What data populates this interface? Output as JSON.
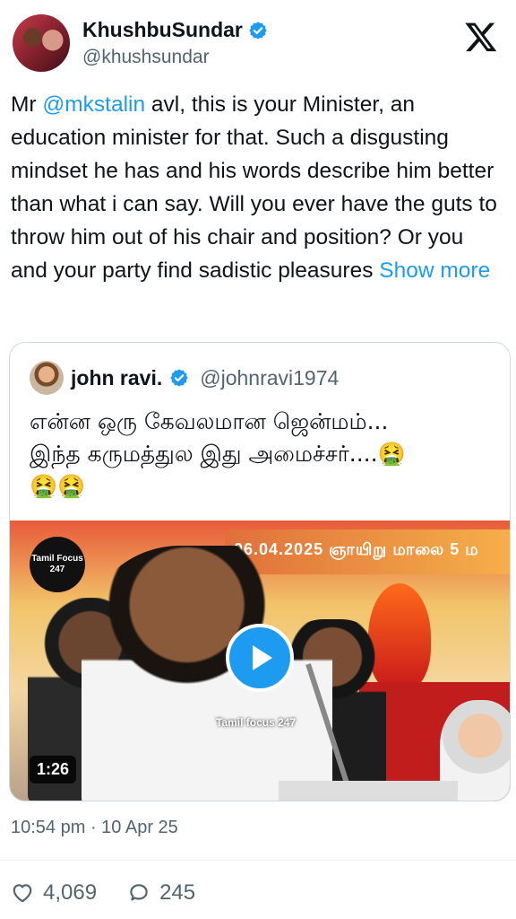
{
  "author": {
    "display_name": "KhushbuSundar",
    "handle": "@khushsundar",
    "verified_color": "#1d9bf0"
  },
  "tweet": {
    "text_before_mention": "Mr ",
    "mention": "@mkstalin",
    "text_after_mention": " avl, this is your Minister, an education minister for that. Such a disgusting mindset he has and his words describe him better than what i can say. Will you ever have the guts to throw him out of his chair and position? Or you and your party find sadistic pleasures ",
    "show_more": "Show more"
  },
  "quoted": {
    "display_name": "john ravi.",
    "handle": "@johnravi1974",
    "text_line1": "என்ன ஒரு கேவலமான ஜென்மம்...",
    "text_line2": "இந்த கருமத்துல இது அமைச்சர்....🤮",
    "text_line3": "🤮🤮",
    "media": {
      "channel_logo_line1": "Tamil Focus",
      "channel_logo_line2": "247",
      "banner_text": "06.04.2025 ஞாயிறு மாலை 5 ம",
      "watermark": "Tamil focus 247",
      "duration": "1:26"
    }
  },
  "timestamp": "10:54 pm · 10 Apr 25",
  "stats": {
    "likes": "4,069",
    "replies": "245"
  },
  "colors": {
    "link": "#1d9bf0",
    "secondary_text": "#536471",
    "primary_text": "#0f1419"
  }
}
